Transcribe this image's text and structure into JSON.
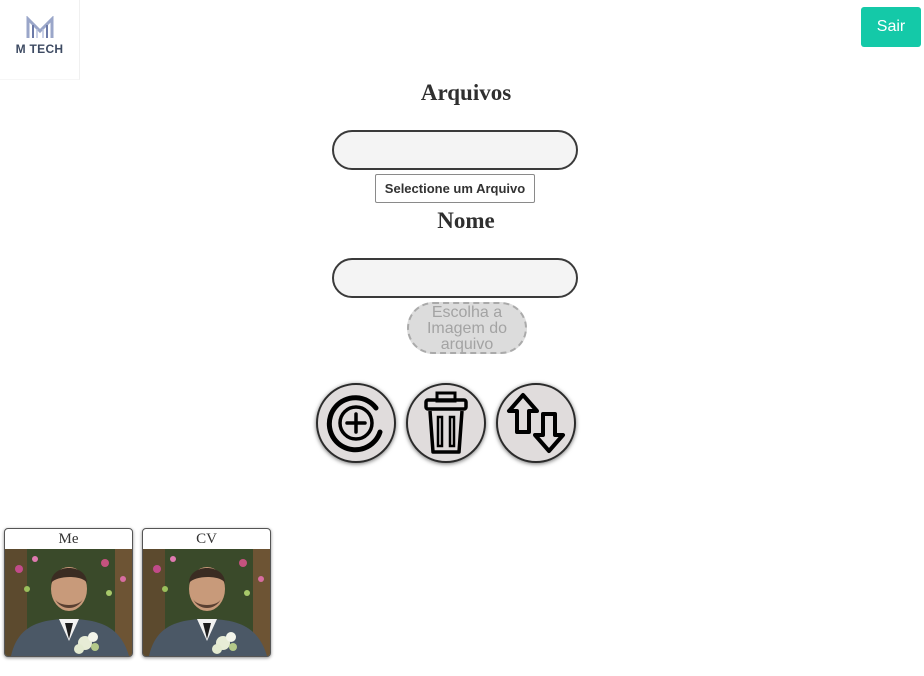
{
  "header": {
    "logo": {
      "text": "M TECH",
      "icon": "m-tech-logo-icon"
    },
    "logout_label": "Sair",
    "logout_color": "#14c9a8"
  },
  "form": {
    "files_heading": "Arquivos",
    "file_input_value": "",
    "select_file_label": "Selectione um Arquivo",
    "name_heading": "Nome",
    "name_input_value": "",
    "choose_image_label": "Escolha a Imagem do arquivo"
  },
  "actions": [
    {
      "name": "add",
      "icon": "add-circle-icon"
    },
    {
      "name": "delete",
      "icon": "trash-icon"
    },
    {
      "name": "swap",
      "icon": "swap-arrows-icon"
    }
  ],
  "files": [
    {
      "title": "Me",
      "image": "portrait-photo"
    },
    {
      "title": "CV",
      "image": "portrait-photo"
    }
  ]
}
